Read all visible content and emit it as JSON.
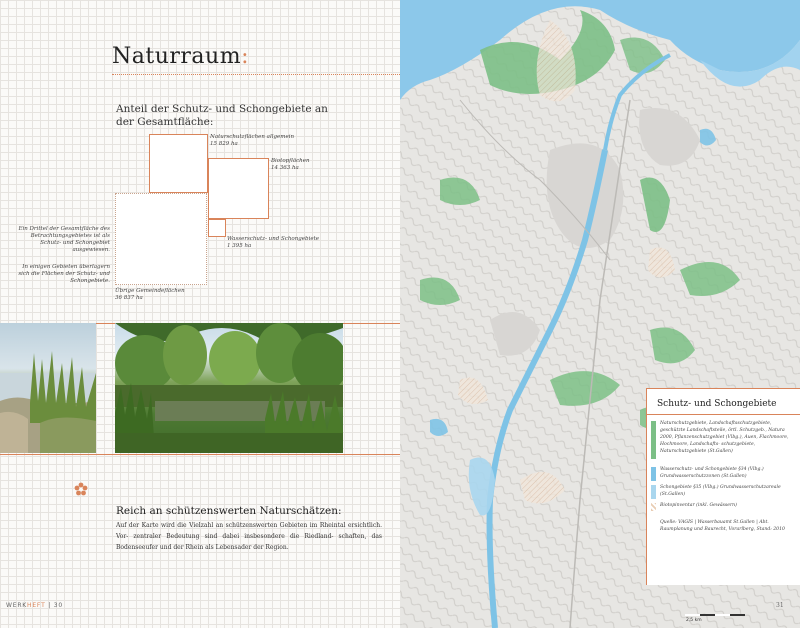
{
  "left_page": {
    "title": "Naturraum",
    "title_colon": ":",
    "subtitle": "Anteil der Schutz- und Schongebiete an der Gesamtfläche:",
    "squares": {
      "naturschutz_label": "Naturschutzflächen allgemein",
      "naturschutz_value": "15 829 ha",
      "biotop_label": "Biotopflächen",
      "biotop_value": "14 363 ha",
      "wasser_label": "Wasserschutz- und Schongebiete",
      "wasser_value": "1 395 ha",
      "gemeinde_label": "Übrige Gemeindeflächen",
      "gemeinde_value": "36 837 ha"
    },
    "side_note_1": "Ein Drittel der Gesamtfläche des Betrachtungsgebietes ist als Schutz- und Schongebiet ausgewiesen.",
    "side_note_2": "In einigen Gebieten überlagern sich die Flächen der Schutz- und Schongebiete.",
    "section_heading": "Reich an schützenswerten Naturschätzen:",
    "section_body": "Auf der Karte wird die Vielzahl an schützenswerten Gebieten im Rheintal ersichtlich. Vor- zentraler Bedeutung sind dabei insbesondere die Riedland- schaften, das Bodenseeufer und der Rhein als Lebensader der Region.",
    "footer_brand_a": "WERK",
    "footer_brand_b": "HEFT",
    "footer_page": "| 30"
  },
  "right_page": {
    "legend_title": "Schutz- und Schongebiete",
    "legend_items": [
      {
        "color": "#7cbf86",
        "text": "Naturschutzgebiete, Landschaftsschutzgebiete, geschützte Landschaftsteile, örtl. Schutzgeb., Natura 2000, Pflanzenschutzgebiet (Vlbg.), Auen, Flachmoore, Hochmoore, Landschafts- schutzgebiete, Naturschutzgebiete (St.Gallen)"
      },
      {
        "color": "#7ec3e6",
        "text": "Wasserschutz- und Schongebiete §34 (Vlbg.) Grundwasserschutzzonen (St.Gallen)"
      },
      {
        "color": "#a9d6ee",
        "text": "Schongebiete §35 (Vlbg.) Grundwasserschutzareale (St.Gallen)"
      },
      {
        "color": "#e9cdb4",
        "text": "Biotopinventar (inkl. Gewässern)"
      }
    ],
    "legend_source": "Quelle: VAGIS | Wasserbauamt St.Gallen | Abt. Raumplanung und Baurecht, Vorarlberg, Stand: 2010",
    "scale_label": "2,5 km",
    "page_number": "31"
  },
  "colors": {
    "accent": "#d9845a",
    "protected_green": "#7cbf86",
    "water_blue": "#7ec3e6",
    "lake_blue": "#8cc8ea"
  }
}
